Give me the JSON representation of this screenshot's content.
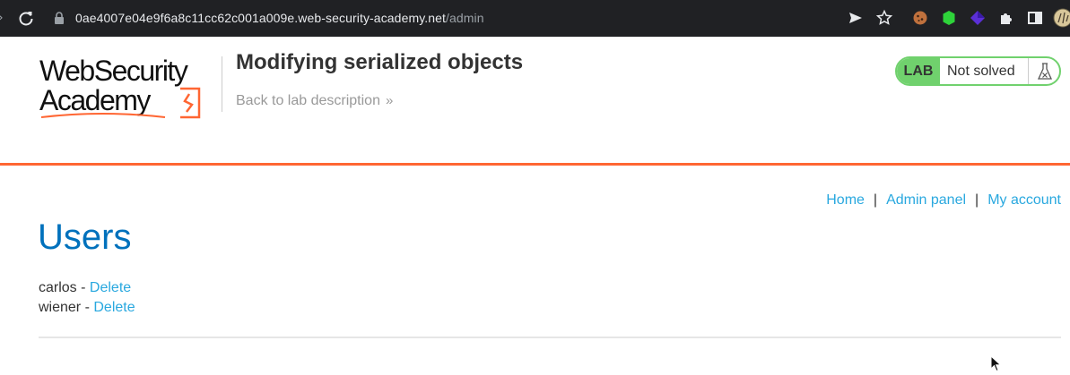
{
  "browser": {
    "url_host": "0ae4007e04e9f6a8c11cc62c001a009e.web-security-academy.net",
    "url_path": "/admin",
    "icons": [
      "reload-icon",
      "lock-icon",
      "send-icon",
      "star-icon",
      "cookie-extension-icon",
      "green-extension-icon",
      "purple-extension-icon",
      "puzzle-icon",
      "sidebar-icon",
      "profile-avatar"
    ]
  },
  "header": {
    "logo_line1": "WebSecurity",
    "logo_line2": "Academy",
    "lab_title": "Modifying serialized objects",
    "back_link": "Back to lab description",
    "back_chevron": "»",
    "lab_badge": "LAB",
    "lab_status": "Not solved"
  },
  "nav": {
    "home": "Home",
    "separator": "|",
    "admin_panel": "Admin panel",
    "my_account": "My account"
  },
  "main": {
    "heading": "Users",
    "users": [
      {
        "name": "carlos",
        "dash": " - ",
        "action": "Delete"
      },
      {
        "name": "wiener",
        "dash": " - ",
        "action": "Delete"
      }
    ]
  },
  "colors": {
    "chrome_bg": "#202124",
    "accent_orange": "#ff6633",
    "link_blue": "#29a8df",
    "heading_blue": "#0071bc",
    "lab_green": "#70d16d"
  }
}
